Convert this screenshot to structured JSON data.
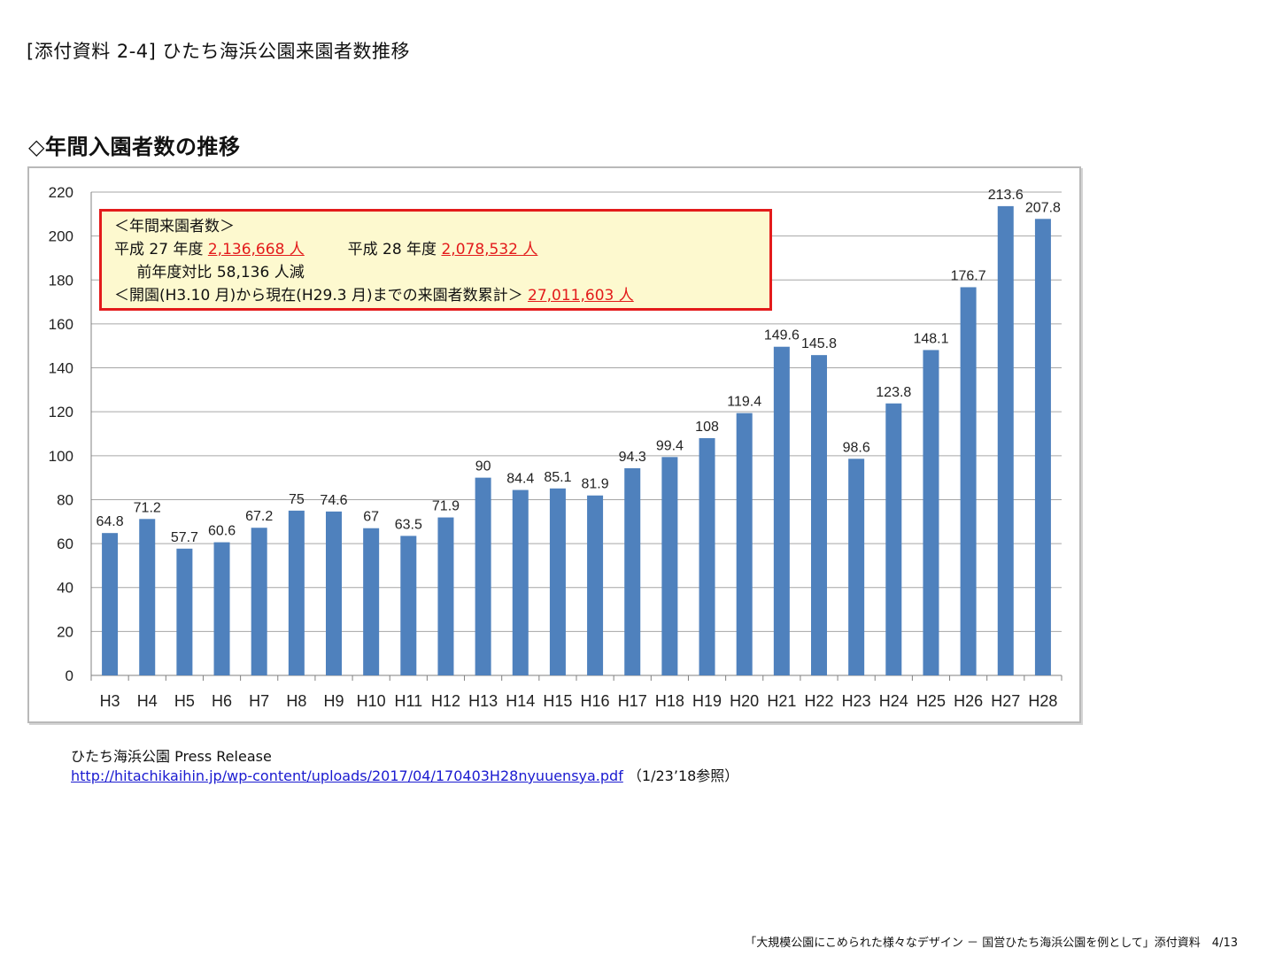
{
  "document_title": "[添付資料 2-4] ひたち海浜公園来園者数推移",
  "section_title": "◇年間入園者数の推移",
  "info_box": {
    "heading": "＜年間来園者数＞",
    "h27_label": "平成 27 年度",
    "h27_value": "2,136,668 人",
    "h28_label": "平成 28 年度",
    "h28_value": "2,078,532 人",
    "change_label": "前年度対比",
    "change_value": "58,136 人減",
    "cumulative_label": "＜開園(H3.10 月)から現在(H29.3 月)までの来園者数累計＞",
    "cumulative_value": "27,011,603 人"
  },
  "chart_data": {
    "type": "bar",
    "categories": [
      "H3",
      "H4",
      "H5",
      "H6",
      "H7",
      "H8",
      "H9",
      "H10",
      "H11",
      "H12",
      "H13",
      "H14",
      "H15",
      "H16",
      "H17",
      "H18",
      "H19",
      "H20",
      "H21",
      "H22",
      "H23",
      "H24",
      "H25",
      "H26",
      "H27",
      "H28"
    ],
    "values": [
      64.8,
      71.2,
      57.7,
      60.6,
      67.2,
      75,
      74.6,
      67,
      63.5,
      71.9,
      90,
      84.4,
      85.1,
      81.9,
      94.3,
      99.4,
      108,
      119.4,
      149.6,
      145.8,
      98.6,
      123.8,
      148.1,
      176.7,
      213.6,
      207.8
    ],
    "ylim": [
      0,
      220
    ],
    "yticks": [
      0,
      20,
      40,
      60,
      80,
      100,
      120,
      140,
      160,
      180,
      200,
      220
    ],
    "bar_color": "#4f81bd",
    "grid": true
  },
  "source": {
    "name": "ひたち海浜公園 Press Release",
    "url_text": "http://hitachikaihin.jp/wp-content/uploads/2017/04/170403H28nyuuensya.pdf",
    "note": "（1/23’18参照）"
  },
  "footer": "「大規模公園にこめられた様々なデザイン － 国営ひたち海浜公園を例として」添付資料　4/13"
}
